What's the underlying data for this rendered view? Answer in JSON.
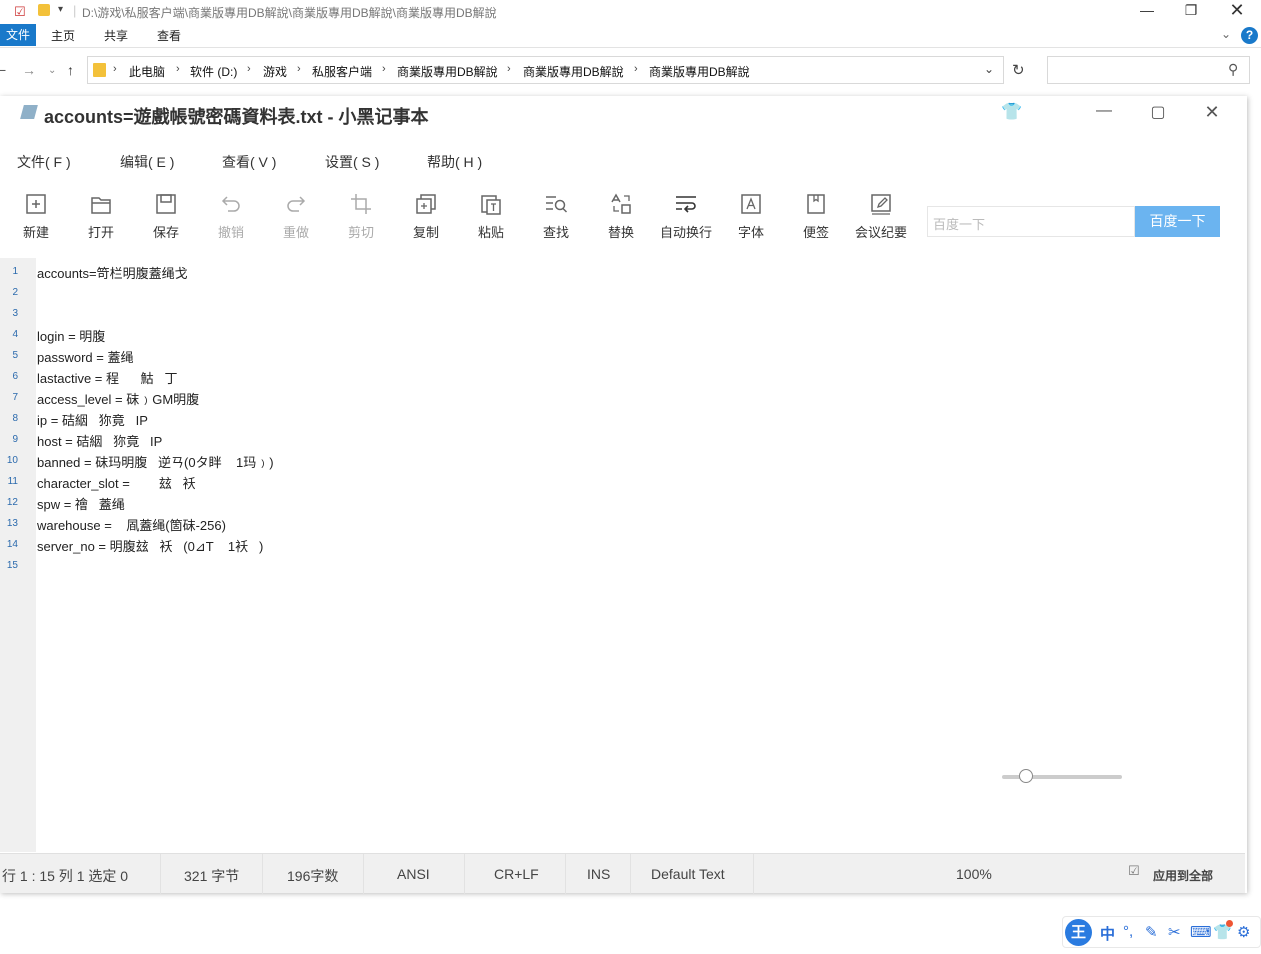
{
  "explorer": {
    "path_title": "D:\\游戏\\私服客户端\\商業版專用DB解說\\商業版專用DB解說\\商業版專用DB解說",
    "ribbon": {
      "file": "文件",
      "home": "主页",
      "share": "共享",
      "view": "查看"
    },
    "breadcrumb": [
      "此电脑",
      "软件 (D:)",
      "游戏",
      "私服客户端",
      "商業版專用DB解說",
      "商業版專用DB解說",
      "商業版專用DB解說"
    ],
    "search_placeholder": ""
  },
  "notepad": {
    "title": "accounts=遊戲帳號密碼資料表.txt - 小黑记事本",
    "menu": [
      "文件( F )",
      "编辑( E )",
      "查看( V )",
      "设置( S )",
      "帮助( H )"
    ],
    "toolbar": [
      {
        "label": "新建",
        "icon": "new-icon",
        "enabled": true
      },
      {
        "label": "打开",
        "icon": "folder-icon",
        "enabled": true
      },
      {
        "label": "保存",
        "icon": "save-icon",
        "enabled": true
      },
      {
        "label": "撤销",
        "icon": "undo-icon",
        "enabled": false
      },
      {
        "label": "重做",
        "icon": "redo-icon",
        "enabled": false
      },
      {
        "label": "剪切",
        "icon": "crop-icon",
        "enabled": false
      },
      {
        "label": "复制",
        "icon": "copy-icon",
        "enabled": true
      },
      {
        "label": "粘贴",
        "icon": "paste-icon",
        "enabled": true
      },
      {
        "label": "查找",
        "icon": "find-icon",
        "enabled": true
      },
      {
        "label": "替换",
        "icon": "replace-icon",
        "enabled": true
      },
      {
        "label": "自动换行",
        "icon": "wrap-icon",
        "enabled": true
      },
      {
        "label": "字体",
        "icon": "font-icon",
        "enabled": true
      },
      {
        "label": "便签",
        "icon": "note-icon",
        "enabled": true
      },
      {
        "label": "会议纪要",
        "icon": "minutes-icon",
        "enabled": true
      }
    ],
    "baidu_placeholder": "百度一下",
    "baidu_button": "百度一下",
    "lines": [
      "accounts=笴栏明腹蓋绳戈",
      "",
      "",
      "login = 明腹",
      "password = 蓋绳",
      "lastactive = 程      鮕   丁",
      "access_level = 砞﹚GM明腹",
      "ip = 硈絪   狝竟   IP",
      "host = 硈絪   狝竟   IP",
      "banned = 砞玛明腹   逆ㄢ(0タ眫    1玛﹚)",
      "character_slot =        玆   袄",
      "spw = 禬   蓋绳",
      "warehouse =    凮蓋绳(箇砞-256)",
      "server_no = 明腹玆   袄   (0⊿T    1袄   )",
      ""
    ],
    "status": {
      "position": "行 1 : 15   列 1   选定 0",
      "bytes": "321 字节",
      "chars": "196字数",
      "encoding": "ANSI",
      "eol": "CR+LF",
      "mode": "INS",
      "style": "Default Text",
      "zoom": "100%",
      "zoom_fraction": 0.2,
      "apply_all": "应用到全部"
    }
  },
  "ime": {
    "logo": "王",
    "mode": "中"
  }
}
